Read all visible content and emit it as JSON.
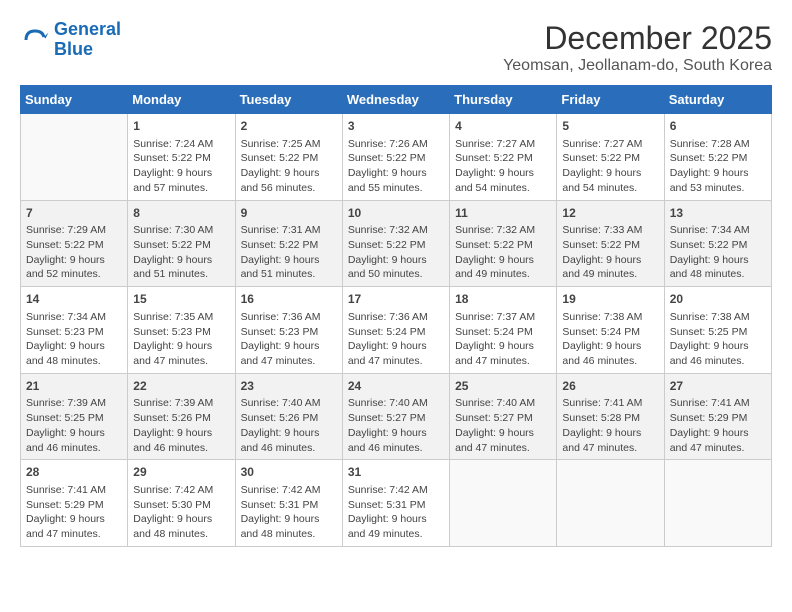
{
  "header": {
    "logo_general": "General",
    "logo_blue": "Blue",
    "title": "December 2025",
    "subtitle": "Yeomsan, Jeollanam-do, South Korea"
  },
  "columns": [
    "Sunday",
    "Monday",
    "Tuesday",
    "Wednesday",
    "Thursday",
    "Friday",
    "Saturday"
  ],
  "weeks": [
    {
      "days": [
        {
          "num": "",
          "empty": true
        },
        {
          "num": "1",
          "sunrise": "7:24 AM",
          "sunset": "5:22 PM",
          "daylight": "9 hours and 57 minutes."
        },
        {
          "num": "2",
          "sunrise": "7:25 AM",
          "sunset": "5:22 PM",
          "daylight": "9 hours and 56 minutes."
        },
        {
          "num": "3",
          "sunrise": "7:26 AM",
          "sunset": "5:22 PM",
          "daylight": "9 hours and 55 minutes."
        },
        {
          "num": "4",
          "sunrise": "7:27 AM",
          "sunset": "5:22 PM",
          "daylight": "9 hours and 54 minutes."
        },
        {
          "num": "5",
          "sunrise": "7:27 AM",
          "sunset": "5:22 PM",
          "daylight": "9 hours and 54 minutes."
        },
        {
          "num": "6",
          "sunrise": "7:28 AM",
          "sunset": "5:22 PM",
          "daylight": "9 hours and 53 minutes."
        }
      ]
    },
    {
      "days": [
        {
          "num": "7",
          "sunrise": "7:29 AM",
          "sunset": "5:22 PM",
          "daylight": "9 hours and 52 minutes."
        },
        {
          "num": "8",
          "sunrise": "7:30 AM",
          "sunset": "5:22 PM",
          "daylight": "9 hours and 51 minutes."
        },
        {
          "num": "9",
          "sunrise": "7:31 AM",
          "sunset": "5:22 PM",
          "daylight": "9 hours and 51 minutes."
        },
        {
          "num": "10",
          "sunrise": "7:32 AM",
          "sunset": "5:22 PM",
          "daylight": "9 hours and 50 minutes."
        },
        {
          "num": "11",
          "sunrise": "7:32 AM",
          "sunset": "5:22 PM",
          "daylight": "9 hours and 49 minutes."
        },
        {
          "num": "12",
          "sunrise": "7:33 AM",
          "sunset": "5:22 PM",
          "daylight": "9 hours and 49 minutes."
        },
        {
          "num": "13",
          "sunrise": "7:34 AM",
          "sunset": "5:22 PM",
          "daylight": "9 hours and 48 minutes."
        }
      ]
    },
    {
      "days": [
        {
          "num": "14",
          "sunrise": "7:34 AM",
          "sunset": "5:23 PM",
          "daylight": "9 hours and 48 minutes."
        },
        {
          "num": "15",
          "sunrise": "7:35 AM",
          "sunset": "5:23 PM",
          "daylight": "9 hours and 47 minutes."
        },
        {
          "num": "16",
          "sunrise": "7:36 AM",
          "sunset": "5:23 PM",
          "daylight": "9 hours and 47 minutes."
        },
        {
          "num": "17",
          "sunrise": "7:36 AM",
          "sunset": "5:24 PM",
          "daylight": "9 hours and 47 minutes."
        },
        {
          "num": "18",
          "sunrise": "7:37 AM",
          "sunset": "5:24 PM",
          "daylight": "9 hours and 47 minutes."
        },
        {
          "num": "19",
          "sunrise": "7:38 AM",
          "sunset": "5:24 PM",
          "daylight": "9 hours and 46 minutes."
        },
        {
          "num": "20",
          "sunrise": "7:38 AM",
          "sunset": "5:25 PM",
          "daylight": "9 hours and 46 minutes."
        }
      ]
    },
    {
      "days": [
        {
          "num": "21",
          "sunrise": "7:39 AM",
          "sunset": "5:25 PM",
          "daylight": "9 hours and 46 minutes."
        },
        {
          "num": "22",
          "sunrise": "7:39 AM",
          "sunset": "5:26 PM",
          "daylight": "9 hours and 46 minutes."
        },
        {
          "num": "23",
          "sunrise": "7:40 AM",
          "sunset": "5:26 PM",
          "daylight": "9 hours and 46 minutes."
        },
        {
          "num": "24",
          "sunrise": "7:40 AM",
          "sunset": "5:27 PM",
          "daylight": "9 hours and 46 minutes."
        },
        {
          "num": "25",
          "sunrise": "7:40 AM",
          "sunset": "5:27 PM",
          "daylight": "9 hours and 47 minutes."
        },
        {
          "num": "26",
          "sunrise": "7:41 AM",
          "sunset": "5:28 PM",
          "daylight": "9 hours and 47 minutes."
        },
        {
          "num": "27",
          "sunrise": "7:41 AM",
          "sunset": "5:29 PM",
          "daylight": "9 hours and 47 minutes."
        }
      ]
    },
    {
      "days": [
        {
          "num": "28",
          "sunrise": "7:41 AM",
          "sunset": "5:29 PM",
          "daylight": "9 hours and 47 minutes."
        },
        {
          "num": "29",
          "sunrise": "7:42 AM",
          "sunset": "5:30 PM",
          "daylight": "9 hours and 48 minutes."
        },
        {
          "num": "30",
          "sunrise": "7:42 AM",
          "sunset": "5:31 PM",
          "daylight": "9 hours and 48 minutes."
        },
        {
          "num": "31",
          "sunrise": "7:42 AM",
          "sunset": "5:31 PM",
          "daylight": "9 hours and 49 minutes."
        },
        {
          "num": "",
          "empty": true
        },
        {
          "num": "",
          "empty": true
        },
        {
          "num": "",
          "empty": true
        }
      ]
    }
  ]
}
